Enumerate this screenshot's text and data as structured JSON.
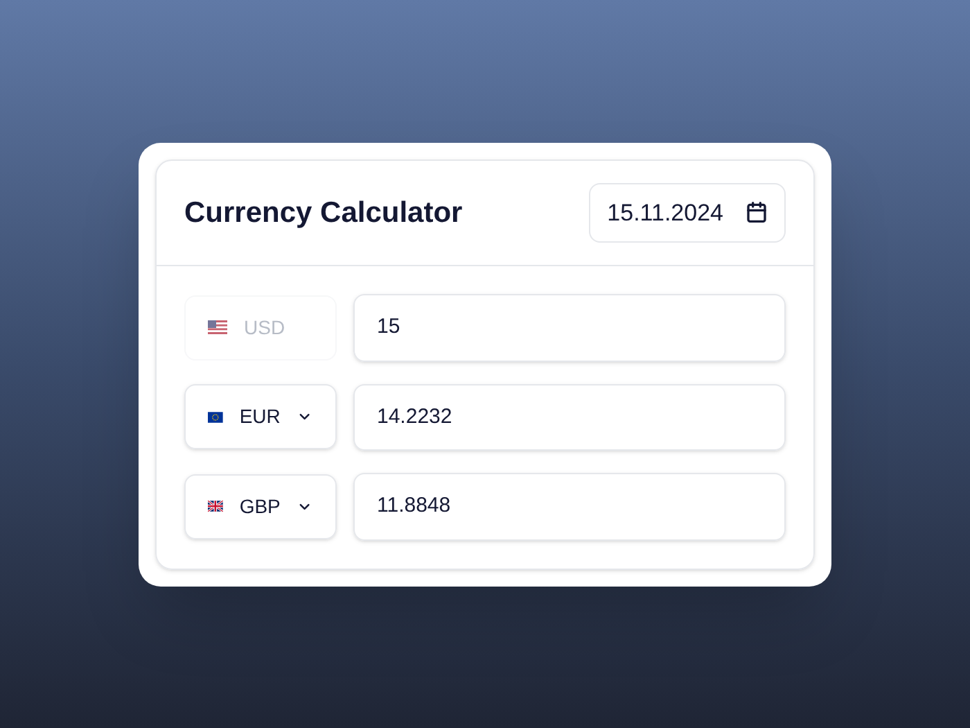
{
  "card": {
    "title": "Currency Calculator",
    "date": "15.11.2024"
  },
  "rows": [
    {
      "currency": "USD",
      "disabled": true,
      "amount": "15"
    },
    {
      "currency": "EUR",
      "disabled": false,
      "amount": "14.2232"
    },
    {
      "currency": "GBP",
      "disabled": false,
      "amount": "11.8848"
    }
  ]
}
